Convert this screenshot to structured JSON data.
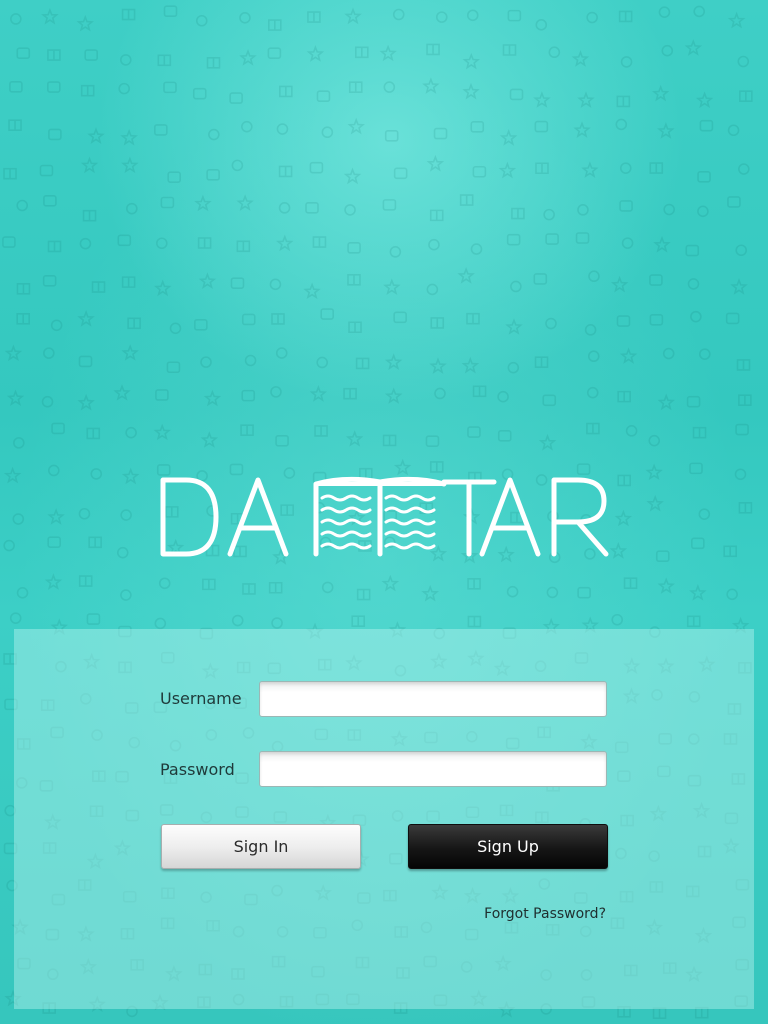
{
  "brand": {
    "name": "DAFTAR",
    "logo_color": "#ffffff"
  },
  "colors": {
    "background": "#3bcbc2",
    "panel": "#bff5f0",
    "signup_button": "#111111",
    "signin_button": "#eeeeee"
  },
  "login_form": {
    "username_label": "Username",
    "username_value": "",
    "password_label": "Password",
    "password_value": "",
    "signin_label": "Sign In",
    "signup_label": "Sign Up",
    "forgot_label": "Forgot Password?"
  }
}
